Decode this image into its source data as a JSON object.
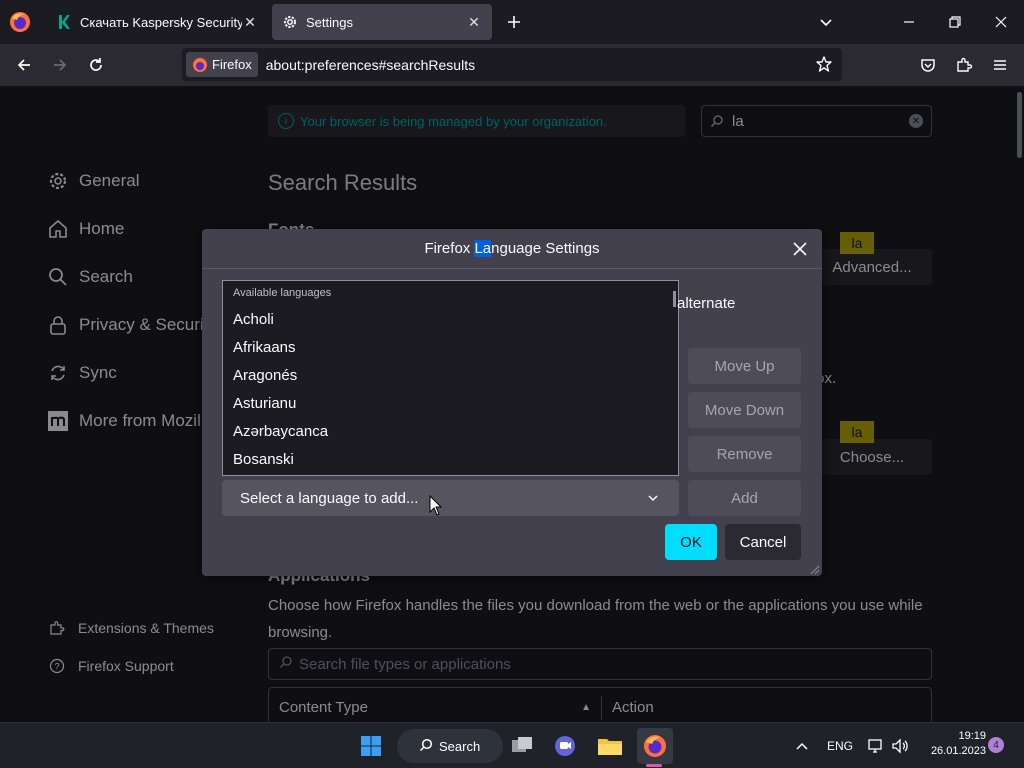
{
  "browser": {
    "tabs": [
      {
        "title": "Скачать Kaspersky Security Cloud",
        "favicon": "kaspersky-k-icon"
      },
      {
        "title": "Settings",
        "favicon": "gear-icon",
        "active": true
      }
    ],
    "identity_label": "Firefox",
    "url": "about:preferences#searchResults"
  },
  "banner": {
    "managed_text": "Your browser is being managed by your organization."
  },
  "pref_search": {
    "query": "la"
  },
  "sidebar": {
    "categories": [
      {
        "label": "General",
        "icon": "gear-icon"
      },
      {
        "label": "Home",
        "icon": "home-icon"
      },
      {
        "label": "Search",
        "icon": "search-icon"
      },
      {
        "label": "Privacy & Security",
        "icon": "lock-icon"
      },
      {
        "label": "Sync",
        "icon": "sync-icon"
      },
      {
        "label": "More from Mozilla",
        "icon": "mozilla-m-icon"
      }
    ],
    "extensions_label": "Extensions & Themes",
    "support_label": "Firefox Support"
  },
  "main": {
    "heading": "Search Results",
    "fonts_heading": "Fonts",
    "advanced_button": "Advanced...",
    "choose_button": "Choose...",
    "highlight_tag": "la",
    "bg_fragment": "fox.",
    "applications_heading": "Applications",
    "applications_desc": "Choose how Firefox handles the files you download from the web or the applications you use while browsing.",
    "filetype_search_placeholder": "Search file types or applications",
    "table": {
      "col1": "Content Type",
      "col2": "Action"
    }
  },
  "dialog": {
    "title_before": "Firefox ",
    "title_highlight": "La",
    "title_after": "nguage Settings",
    "list_header": "Available languages",
    "languages": [
      "Acholi",
      "Afrikaans",
      "Aragonés",
      "Asturianu",
      "Azərbaycanca",
      "Bosanski"
    ],
    "alternate_fragment": "alternate",
    "buttons": {
      "move_up": "Move Up",
      "move_down": "Move Down",
      "remove": "Remove",
      "add": "Add",
      "ok": "OK",
      "cancel": "Cancel"
    },
    "select_placeholder": "Select a language to add..."
  },
  "taskbar": {
    "search_label": "Search",
    "language": "ENG",
    "time": "19:19",
    "date": "26.01.2023",
    "notifications": "4"
  },
  "colors": {
    "accent": "#00ddff",
    "highlight": "#0061e0",
    "managed_text": "#00b3b3",
    "tip": "#ffe900"
  }
}
